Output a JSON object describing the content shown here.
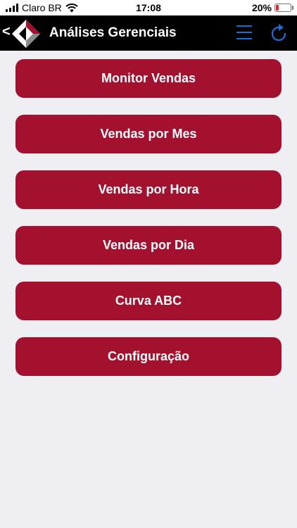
{
  "status": {
    "carrier": "Claro BR",
    "time": "17:08",
    "battery_text": "20%",
    "battery_level": 0.2
  },
  "header": {
    "back_symbol": "<",
    "title": "Análises Gerenciais",
    "menu_icon": "hamburger-menu-icon",
    "refresh_icon": "refresh-icon",
    "accent_color": "#1a6fd6"
  },
  "menu": {
    "button_color": "#a3112f",
    "items": [
      {
        "label": "Monitor Vendas"
      },
      {
        "label": "Vendas por Mes"
      },
      {
        "label": "Vendas por Hora"
      },
      {
        "label": "Vendas por Dia"
      },
      {
        "label": "Curva ABC"
      },
      {
        "label": "Configuração"
      }
    ]
  }
}
